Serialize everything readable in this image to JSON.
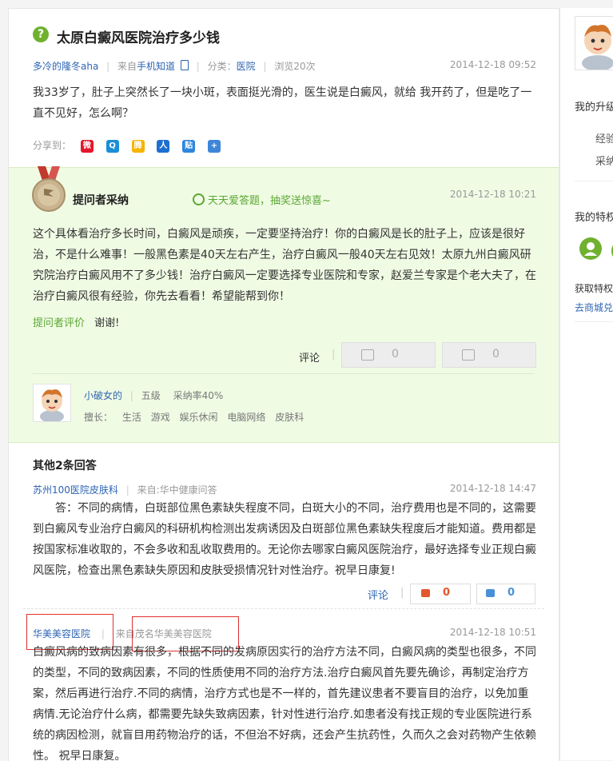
{
  "question": {
    "icon": "question-mark-icon",
    "icon_glyph": "?",
    "title": "太原白癜风医院治疗多少钱",
    "author": "多冷的隆冬aha",
    "source_prefix": "来自",
    "source": "手机知道",
    "category_prefix": "分类：",
    "category": "医院",
    "views": "浏览20次",
    "time": "2014-12-18 09:52",
    "content": "我33岁了，肚子上突然长了一块小斑，表面挺光滑的，医生说是白癜风，就给 我开药了，但是吃了一直不见好，怎么啊？",
    "share_label": "分享到：",
    "share_targets": [
      "weibo-icon",
      "qzone-icon",
      "qq-weibo-icon",
      "renren-icon",
      "tieba-icon",
      "more-share-icon"
    ]
  },
  "best_answer": {
    "badge_label": "提问者采纳",
    "promo": "天天爱答题，抽奖送惊喜~",
    "time": "2014-12-18 10:21",
    "content": "这个具体看治疗多长时间，白癜风是顽疾，一定要坚持治疗！你的白癜风是长的肚子上，应该是很好治，不是什么难事！一般黑色素是40天左右产生，治疗白癜风一般40天左右见效！太原九州白癜风研究院治疗白癜风用不了多少钱！治疗白癜风一定要选择专业医院和专家，赵爱兰专家是个老大夫了，在治疗白癜风很有经验，你先去看看！希望能帮到你！",
    "asker_eval_label": "提问者评价",
    "asker_eval": "谢谢!",
    "comment_label": "评论",
    "up_count": "0",
    "down_count": "0",
    "answerer": {
      "name": "小破女的",
      "level": "五级",
      "adopt_rate": "采纳率40%",
      "expertise_label": "擅长：",
      "expertise": [
        "生活",
        "游戏",
        "娱乐休闲",
        "电脑网络",
        "皮肤科"
      ]
    }
  },
  "other_answers": {
    "heading": "其他2条回答",
    "items": [
      {
        "author": "苏州100医院皮肤科",
        "source": "来自:华中健康问答",
        "time": "2014-12-18 14:47",
        "content": "答：不同的病情，白斑部位黑色素缺失程度不同，白斑大小的不同，治疗费用也是不同的，这需要到白癜风专业治疗白癜风的科研机构检测出发病诱因及白斑部位黑色素缺失程度后才能知道。费用都是按国家标准收取的，不会多收和乱收取费用的。无论你去哪家白癜风医院治疗，最好选择专业正规白癜风医院，检查出黑色素缺失原因和皮肤受损情况针对性治疗。祝早日康复!",
        "comment_label": "评论",
        "up_count": "0",
        "down_count": "0"
      },
      {
        "author": "华美美容医院",
        "source_prefix": "来自",
        "source": "茂名华美美容医院",
        "time": "2014-12-18 10:51",
        "content": "白癜风病的致病因素有很多，根据不同的发病原因实行的治疗方法不同，白癜风病的类型也很多，不同的类型，不同的致病因素，不同的性质使用不同的治疗方法.治疗白癜风首先要先确诊，再制定治疗方案，然后再进行治疗.不同的病情，治疗方式也是不一样的，首先建议患者不要盲目的治疗，以免加重病情.无论治疗什么病，都需要先缺失致病因素，针对性进行治疗.如患者没有找正规的专业医院进行系统的病因检测，就盲目用药物治疗的话，不但治不好病，还会产生抗药性，久而久之会对药物产生依赖性。 祝早日康复。"
      }
    ]
  },
  "sidebar": {
    "upgrade_title": "我的升级",
    "upgrade_items": [
      "经验",
      "采纳"
    ],
    "privilege_title": "我的特权",
    "privilege_text": "获取特权",
    "privilege_link": "去商城兑"
  },
  "colors": {
    "accent_green": "#6fb12f",
    "link_blue": "#2d64b3",
    "best_bg": "#f0fbe4",
    "promo_green": "#5aa832",
    "up_red": "#e2572c"
  }
}
